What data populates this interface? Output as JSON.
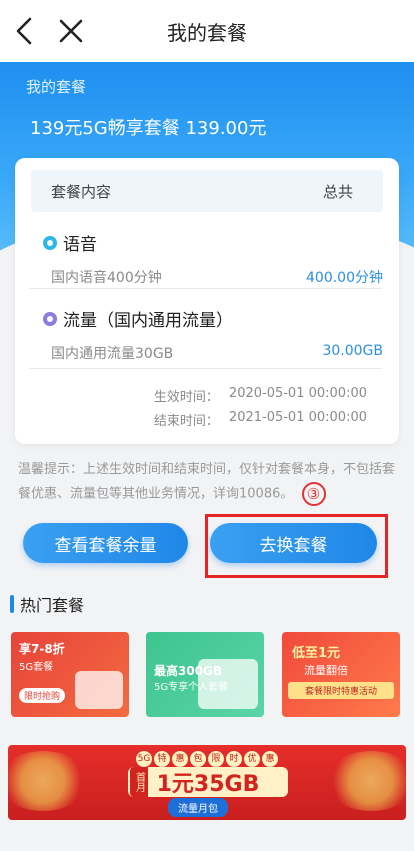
{
  "nav": {
    "title": "我的套餐"
  },
  "hero": {
    "label": "我的套餐",
    "package_name": "139元5G畅享套餐 139.00元"
  },
  "card": {
    "col_left": "套餐内容",
    "col_right": "总共",
    "items": [
      {
        "name": "语音",
        "detail": "国内语音400分钟",
        "value": "400.00分钟",
        "color": "#29b6e8"
      },
      {
        "name": "流量（国内通用流量）",
        "detail": "国内通用流量30GB",
        "value": "30.00GB",
        "color": "#8c7be0"
      }
    ],
    "start_label": "生效时间：",
    "start_value": "2020-05-01 00:00:00",
    "end_label": "结束时间：",
    "end_value": "2021-05-01 00:00:00"
  },
  "tip": {
    "text": "温馨提示：上述生效时间和结束时间，仅针对套餐本身，不包括套餐优惠、流量包等其他业务情况，详询10086。",
    "annotation": "③"
  },
  "buttons": {
    "balance": "查看套餐余量",
    "change": "去换套餐"
  },
  "hot": {
    "title": "热门套餐",
    "promos": [
      {
        "line1": "享7-8折",
        "line2": "5G套餐",
        "tag": "限时抢购"
      },
      {
        "line1": "最高300GB",
        "line2": "5G专享个人套餐",
        "tag": ""
      },
      {
        "line1": "低至1元",
        "line2": "流量翻倍",
        "tag": "套餐限时特惠活动"
      }
    ]
  },
  "banner": {
    "tagline": [
      "5G",
      "特",
      "惠",
      "包",
      "限",
      "时",
      "优",
      "惠"
    ],
    "first": "首月",
    "main": "1元35GB",
    "sub": "流量月包"
  },
  "colors": {
    "accent": "#1f87e8",
    "annotation": "#e52424"
  }
}
